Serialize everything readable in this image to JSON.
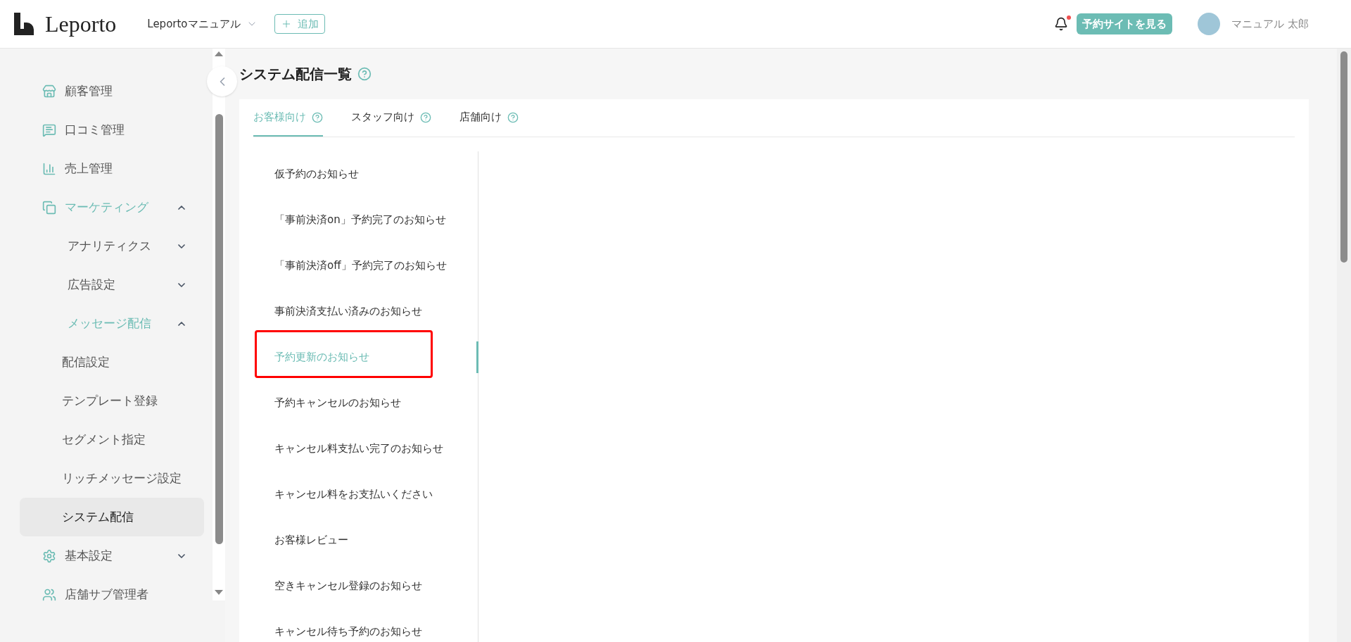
{
  "header": {
    "logo": "Leporto",
    "store_selector": "Leportoマニュアル",
    "add_button": "追加",
    "notification": {
      "unread": true
    },
    "site_button": "予約サイトを見る",
    "user_name": "マニュアル 太郎"
  },
  "sidebar": {
    "items": [
      {
        "label": "顧客管理",
        "active": false
      },
      {
        "label": "口コミ管理",
        "active": false
      },
      {
        "label": "売上管理",
        "active": false
      },
      {
        "label": "マーケティング",
        "active": true,
        "expanded": true,
        "children": [
          {
            "label": "アナリティクス",
            "active": false,
            "expanded": false
          },
          {
            "label": "広告設定",
            "active": false,
            "expanded": false
          },
          {
            "label": "メッセージ配信",
            "active": true,
            "expanded": true,
            "children": [
              {
                "label": "配信設定",
                "selected": false
              },
              {
                "label": "テンプレート登録",
                "selected": false
              },
              {
                "label": "セグメント指定",
                "selected": false
              },
              {
                "label": "リッチメッセージ設定",
                "selected": false
              },
              {
                "label": "システム配信",
                "selected": true
              }
            ]
          }
        ]
      },
      {
        "label": "基本設定",
        "active": false,
        "expanded": false
      },
      {
        "label": "店舗サブ管理者",
        "active": false
      }
    ]
  },
  "page": {
    "title": "システム配信一覧",
    "tabs": [
      {
        "label": "お客様向け",
        "selected": true
      },
      {
        "label": "スタッフ向け",
        "selected": false
      },
      {
        "label": "店舗向け",
        "selected": false
      }
    ],
    "messages": [
      {
        "label": "仮予約のお知らせ",
        "selected": false,
        "highlighted": false
      },
      {
        "label": "「事前決済on」予約完了のお知らせ",
        "selected": false,
        "highlighted": false
      },
      {
        "label": "「事前決済off」予約完了のお知らせ",
        "selected": false,
        "highlighted": false
      },
      {
        "label": "事前決済支払い済みのお知らせ",
        "selected": false,
        "highlighted": false
      },
      {
        "label": "予約更新のお知らせ",
        "selected": true,
        "highlighted": true
      },
      {
        "label": "予約キャンセルのお知らせ",
        "selected": false,
        "highlighted": false
      },
      {
        "label": "キャンセル料支払い完了のお知らせ",
        "selected": false,
        "highlighted": false
      },
      {
        "label": "キャンセル料をお支払いください",
        "selected": false,
        "highlighted": false
      },
      {
        "label": "お客様レビュー",
        "selected": false,
        "highlighted": false
      },
      {
        "label": "空きキャンセル登録のお知らせ",
        "selected": false,
        "highlighted": false
      },
      {
        "label": "キャンセル待ち予約のお知らせ",
        "selected": false,
        "highlighted": false
      }
    ]
  }
}
